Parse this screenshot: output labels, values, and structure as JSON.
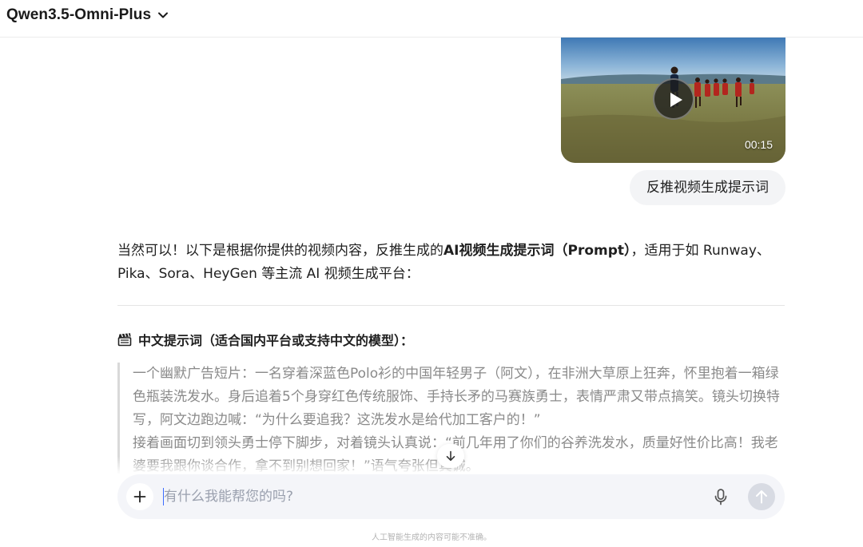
{
  "header": {
    "model_name": "Qwen3.5-Omni-Plus",
    "dropdown_icon": "chevron-down-icon"
  },
  "video": {
    "duration": "00:15",
    "play_icon": "play-icon"
  },
  "user_message": {
    "text": "反推视频生成提示词"
  },
  "answer": {
    "intro_before": "当然可以！以下是根据你提供的视频内容，反推生成的",
    "intro_bold": "AI视频生成提示词（Prompt）",
    "intro_after": "，适用于如 Runway、Pika、Sora、HeyGen 等主流 AI 视频生成平台：",
    "section_icon": "clapperboard-icon",
    "section_title": "中文提示词（适合国内平台或支持中文的模型）：",
    "quote_p1": "一个幽默广告短片：一名穿着深蓝色Polo衫的中国年轻男子（阿文），在非洲大草原上狂奔，怀里抱着一箱绿色瓶装洗发水。身后追着5个身穿红色传统服饰、手持长矛的马赛族勇士，表情严肃又带点搞笑。镜头切换特写，阿文边跑边喊：“为什么要追我？这洗发水是给代加工客户的！”",
    "quote_p2": "接着画面切到领头勇士停下脚步，对着镜头认真说：“前几年用了你们的谷养洗发水，质量好性价比高！我老婆要我跟你谈合作，拿不到别想回家！”语气夸张但真诚。"
  },
  "composer": {
    "placeholder": "有什么我能帮您的吗?",
    "plus_icon": "plus-icon",
    "mic_icon": "microphone-icon",
    "send_icon": "arrow-up-icon"
  },
  "scroll": {
    "icon": "arrow-down-icon"
  },
  "footer": {
    "disclaimer": "人工智能生成的内容可能不准确。"
  },
  "colors": {
    "accent": "#3b6cff",
    "composer_bg": "#f4f5f9",
    "bubble_bg": "#f3f4f6",
    "quote_text": "#8a8a8a"
  }
}
